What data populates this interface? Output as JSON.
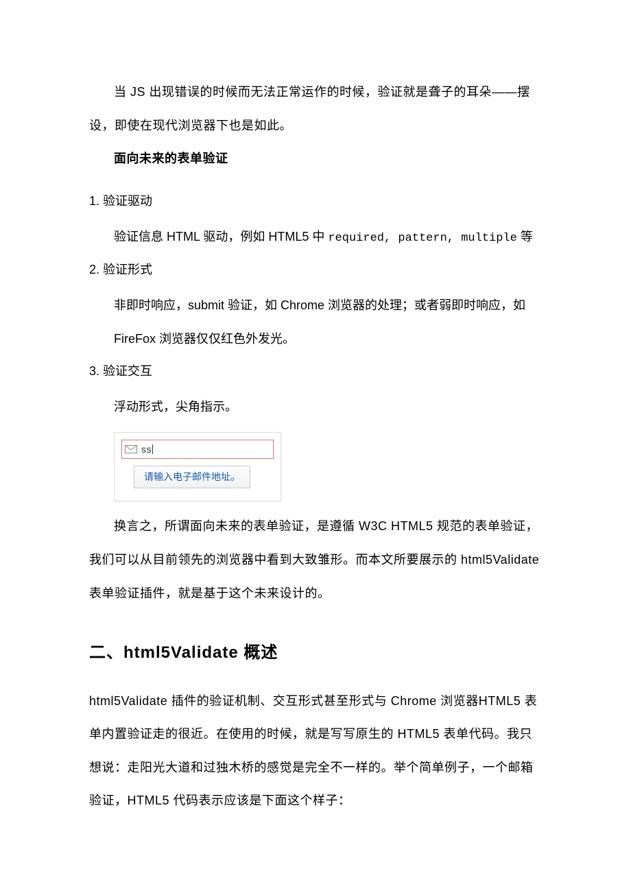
{
  "intro": {
    "p1": "当 JS 出现错误的时候而无法正常运作的时候，验证就是聋子的耳朵——摆设，即使在现代浏览器下也是如此。",
    "bold_heading": "面向未来的表单验证"
  },
  "list": [
    {
      "num": "1.",
      "title": "验证驱动",
      "body_pre": "验证信息 HTML 驱动，例如 HTML5 中 ",
      "body_code": "required, pattern, multiple",
      "body_post": " 等"
    },
    {
      "num": "2.",
      "title": "验证形式",
      "body": "非即时响应，submit 验证，如 Chrome 浏览器的处理；或者弱即时响应，如 FireFox 浏览器仅仅红色外发光。"
    },
    {
      "num": "3.",
      "title": "验证交互",
      "body": "浮动形式，尖角指示。"
    }
  ],
  "figure": {
    "input_value": "ss",
    "tooltip": "请输入电子邮件地址。"
  },
  "para2": "换言之，所谓面向未来的表单验证，是遵循 W3C HTML5 规范的表单验证，我们可以从目前领先的浏览器中看到大致雏形。而本文所要展示的 html5Validate 表单验证插件，就是基于这个未来设计的。",
  "section2": {
    "prefix": "二、",
    "title": "html5Validate 概述",
    "p1": "html5Validate 插件的验证机制、交互形式甚至形式与 Chrome 浏览器HTML5 表单内置验证走的很近。在使用的时候，就是写写原生的 HTML5 表单代码。我只想说：走阳光大道和过独木桥的感觉是完全不一样的。举个简单例子，一个邮箱验证，HTML5 代码表示应该是下面这个样子："
  }
}
